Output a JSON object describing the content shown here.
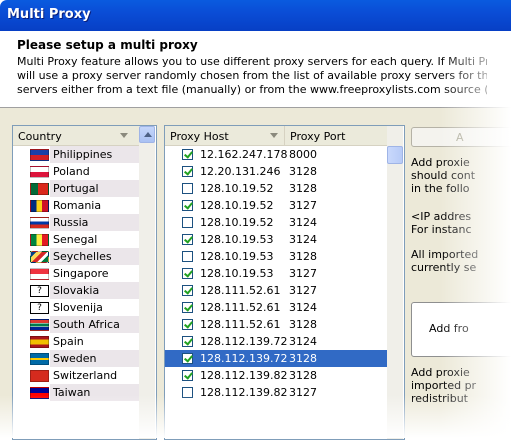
{
  "window": {
    "title": "Multi Proxy"
  },
  "header": {
    "title": "Please setup a multi proxy",
    "lines": [
      "Multi Proxy feature allows you to use different proxy servers for each query. If Multi Proxy feature",
      "will use a proxy server randomly chosen from the list of available proxy servers for that country.",
      "servers either from a text file (manually) or from the www.freeproxylists.com source (automaticall"
    ]
  },
  "country_list": {
    "header": "Country",
    "items": [
      {
        "name": "Philippines",
        "flag": "philippines-flag"
      },
      {
        "name": "Poland",
        "flag": "poland-flag"
      },
      {
        "name": "Portugal",
        "flag": "portugal-flag"
      },
      {
        "name": "Romania",
        "flag": "romania-flag"
      },
      {
        "name": "Russia",
        "flag": "russia-flag"
      },
      {
        "name": "Senegal",
        "flag": "senegal-flag"
      },
      {
        "name": "Seychelles",
        "flag": "seychelles-flag"
      },
      {
        "name": "Singapore",
        "flag": "singapore-flag"
      },
      {
        "name": "Slovakia",
        "flag": "unknown-flag"
      },
      {
        "name": "Slovenija",
        "flag": "unknown-flag"
      },
      {
        "name": "South Africa",
        "flag": "south-africa-flag"
      },
      {
        "name": "Spain",
        "flag": "spain-flag"
      },
      {
        "name": "Sweden",
        "flag": "sweden-flag"
      },
      {
        "name": "Switzerland",
        "flag": "switzerland-flag"
      },
      {
        "name": "Taiwan",
        "flag": "taiwan-flag"
      }
    ],
    "unknown_flag_glyph": "?"
  },
  "proxy_list": {
    "host_header": "Proxy Host",
    "port_header": "Proxy Port",
    "rows": [
      {
        "host": "12.162.247.178",
        "port": "8000",
        "checked": true
      },
      {
        "host": "12.20.131.246",
        "port": "3128",
        "checked": true
      },
      {
        "host": "128.10.19.52",
        "port": "3128",
        "checked": false
      },
      {
        "host": "128.10.19.52",
        "port": "3127",
        "checked": true
      },
      {
        "host": "128.10.19.52",
        "port": "3124",
        "checked": false
      },
      {
        "host": "128.10.19.53",
        "port": "3124",
        "checked": true
      },
      {
        "host": "128.10.19.53",
        "port": "3128",
        "checked": false
      },
      {
        "host": "128.10.19.53",
        "port": "3127",
        "checked": true
      },
      {
        "host": "128.111.52.61",
        "port": "3127",
        "checked": true
      },
      {
        "host": "128.111.52.61",
        "port": "3124",
        "checked": true
      },
      {
        "host": "128.111.52.61",
        "port": "3128",
        "checked": true
      },
      {
        "host": "128.112.139.72",
        "port": "3124",
        "checked": true
      },
      {
        "host": "128.112.139.72",
        "port": "3128",
        "checked": true,
        "selected": true
      },
      {
        "host": "128.112.139.82",
        "port": "3128",
        "checked": true
      },
      {
        "host": "128.112.139.82",
        "port": "3127",
        "checked": false
      }
    ]
  },
  "right_panel": {
    "button_label": "A",
    "para1": [
      "Add proxie",
      "should cont",
      "in the follo"
    ],
    "para2": [
      "<IP addres",
      "For instanc"
    ],
    "para3": [
      "All imported",
      "currently se"
    ],
    "add_box_label": "Add fro",
    "para4": [
      "Add proxie",
      "imported pr",
      "redistribut"
    ]
  }
}
